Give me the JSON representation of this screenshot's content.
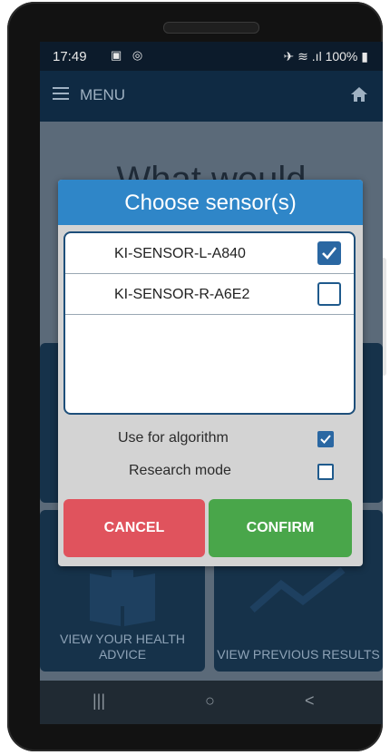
{
  "status_bar": {
    "time": "17:49",
    "battery": "100%"
  },
  "app_bar": {
    "menu_label": "MENU"
  },
  "background": {
    "title_partial": "What would",
    "tiles": [
      {
        "label": "VIEW YOUR HEALTH ADVICE"
      },
      {
        "label": "VIEW PREVIOUS RESULTS"
      }
    ]
  },
  "dialog": {
    "title": "Choose sensor(s)",
    "sensors": [
      {
        "name": "KI-SENSOR-L-A840",
        "checked": true
      },
      {
        "name": "KI-SENSOR-R-A6E2",
        "checked": false
      }
    ],
    "options": [
      {
        "label": "Use for algorithm",
        "checked": true
      },
      {
        "label": "Research mode",
        "checked": false
      }
    ],
    "cancel_label": "CANCEL",
    "confirm_label": "CONFIRM"
  },
  "nav_bar": {
    "recents": "|||",
    "home": "○",
    "back": "<"
  },
  "colors": {
    "dialog_title_bg": "#2f86c8",
    "cancel_bg": "#e0535d",
    "confirm_bg": "#49a64a",
    "checkbox_checked": "#2a67a2"
  }
}
